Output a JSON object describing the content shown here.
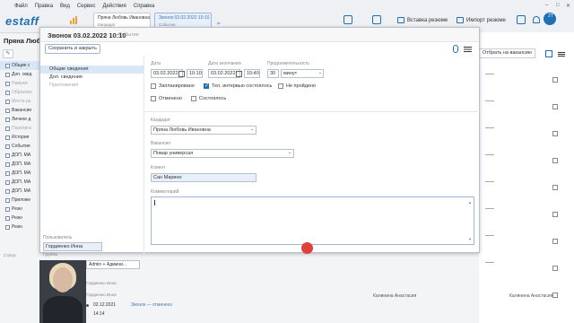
{
  "app": {
    "logo": "estaff",
    "menu": [
      "Файл",
      "Правка",
      "Вид",
      "Сервис",
      "Действия",
      "Справка"
    ],
    "tabs": [
      {
        "title": "Пряна Любовь Ивановна",
        "subtitle": "Кандидат"
      },
      {
        "title": "Звонок 03.02.2022 10:10",
        "subtitle": "Событие"
      }
    ],
    "actions": {
      "insert_resume": "Вставка резюме",
      "import_resume": "Импорт резюме"
    },
    "avatar_badge": "2Т"
  },
  "candidate": {
    "title": "Пряна Любо",
    "nav": [
      {
        "label": "Общие с",
        "selected": true
      },
      {
        "label": "Доп. свед"
      },
      {
        "label": "Навыки",
        "muted": true
      },
      {
        "label": "Образова",
        "muted": true
      },
      {
        "label": "Места ра",
        "muted": true
      },
      {
        "label": "Вакансии"
      },
      {
        "label": "Личное д"
      },
      {
        "label": "Переписк",
        "muted": true
      },
      {
        "label": "История"
      },
      {
        "label": "События"
      },
      {
        "label": "ДОП. МА"
      },
      {
        "label": "ДОП. МА"
      },
      {
        "label": "ДОП. МА"
      },
      {
        "label": "ДОП. МА"
      },
      {
        "label": "ДОП. МА"
      },
      {
        "label": "Приложе"
      },
      {
        "label": "Резю"
      },
      {
        "label": "Резю"
      },
      {
        "label": "Резю"
      }
    ],
    "status_label": "Статус"
  },
  "background": {
    "vacancy_button": "Отбрать на вакансию",
    "names": [
      "Калинина Анастасия",
      "Калинина Анастасия"
    ],
    "bottom_row": {
      "date": "02.12.2021",
      "time": "14:14",
      "event": "Звонок — отменено"
    },
    "group_label": "Группа",
    "group_value": "Admin + Админи...",
    "tag1": "Гордиенко Инна",
    "tag2": "Гордиенко Инна"
  },
  "modal": {
    "title": "Звонок 03.02.2022 10:10",
    "subtitle": "Событие",
    "save_button": "Сохранить и закрыть",
    "side": [
      {
        "label": "Общие сведения",
        "selected": true
      },
      {
        "label": "Доп. сведения"
      },
      {
        "label": "Приложения",
        "muted": true
      }
    ],
    "user_label": "Пользователь",
    "user_value": "Гордиенко Инна",
    "group_label": "Группа",
    "date_label": "Дата",
    "date_value": "03.02.2022",
    "time_value": "10:10",
    "end_label": "Дата окончания",
    "end_date_value": "03.02.2022",
    "end_time_value": "10:40",
    "duration_label": "Продолжительность",
    "duration_value": "30",
    "duration_unit": "минут",
    "checks": [
      {
        "label": "Запланировано",
        "checked": false
      },
      {
        "label": "Тел. интервью состоялось",
        "checked": true
      },
      {
        "label": "Не пройдено",
        "checked": false
      },
      {
        "label": "Отменено",
        "checked": false
      },
      {
        "label": "Состоялось",
        "checked": false
      }
    ],
    "candidate_label": "Кандидат",
    "candidate_value": "Пряна Любовь Ивановна",
    "vacancy_label": "Вакансия",
    "vacancy_value": "Повар универсал",
    "client_label": "Клиент",
    "client_value": "Сан Марино",
    "comment_label": "Комментарий",
    "comment_value": ""
  },
  "colors": {
    "accent": "#1f6fb5",
    "cursor": "#e0413a"
  }
}
